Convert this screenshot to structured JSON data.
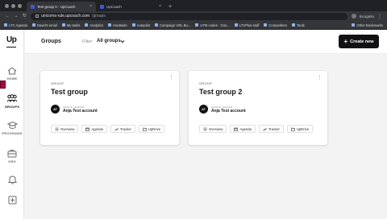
{
  "browser": {
    "tabs": [
      {
        "label": "Test group 0 - UpCoach",
        "active": true
      },
      {
        "label": "UpCoach",
        "active": false
      }
    ],
    "url_host": "unicorns-rule.upcoach.com",
    "url_path": "/groups",
    "profile_label": "Incognito",
    "bookmarks": [
      "LTC Agenda",
      "David's email",
      "My tasks",
      "Analytics",
      "Hootsuite",
      "Autopilot",
      "Campaign URL Bu...",
      "UTM codes - Goo...",
      "LTVPlus stuff",
      "Competitors",
      "Tools"
    ],
    "other_bookmarks": "Other Bookmarks"
  },
  "sidebar": {
    "logo": "Up",
    "items": [
      {
        "label": "HOME",
        "icon": "home-icon",
        "active": false
      },
      {
        "label": "GROUPS",
        "icon": "groups-icon",
        "active": true
      },
      {
        "label": "PROGRAMS",
        "icon": "programs-icon",
        "active": false
      },
      {
        "label": "ORG",
        "icon": "org-icon",
        "active": false
      },
      {
        "label": "",
        "icon": "bell-icon",
        "active": false
      },
      {
        "label": "",
        "icon": "add-square-icon",
        "active": false
      }
    ]
  },
  "header": {
    "title": "Groups",
    "filter_label": "Filter:",
    "filter_value": "All groups",
    "create_button": "Create new"
  },
  "cards": [
    {
      "type": "GROUP",
      "name": "Test group",
      "leader_label": "GROUP LEADER",
      "leader_initials": "AT",
      "leader_name": "Anja Test account",
      "actions": [
        "Overview",
        "Agenda",
        "Tracker",
        "UpDrive"
      ]
    },
    {
      "type": "GROUP",
      "name": "Test group 2",
      "leader_label": "GROUP LEADER",
      "leader_initials": "AT",
      "leader_name": "Anja Test account",
      "actions": [
        "Overview",
        "Agenda",
        "Tracker",
        "UpDrive"
      ]
    }
  ],
  "colors": {
    "accent_dark": "#111114",
    "background": "#f3f3f4",
    "sidebar_marker": "#b0003a"
  }
}
